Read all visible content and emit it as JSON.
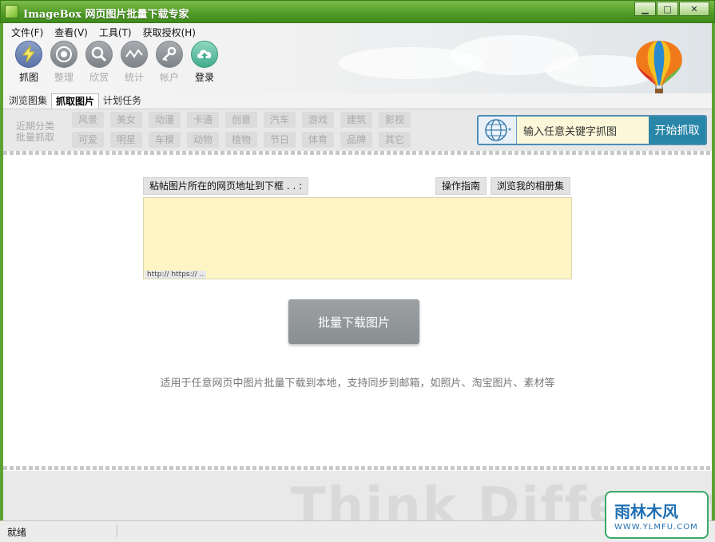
{
  "window": {
    "title": "ImageBox 网页图片批量下载专家",
    "minimize": "▁",
    "maximize": "□",
    "close": "✕"
  },
  "menu": [
    {
      "label": "文件(F)"
    },
    {
      "label": "查看(V)"
    },
    {
      "label": "工具(T)"
    },
    {
      "label": "获取授权(H)"
    }
  ],
  "toolbar": [
    {
      "label": "抓图",
      "icon": "lightning-icon",
      "active": true
    },
    {
      "label": "整理",
      "icon": "eye-icon",
      "active": false
    },
    {
      "label": "欣赏",
      "icon": "magnifier-icon",
      "active": false
    },
    {
      "label": "统计",
      "icon": "chart-icon",
      "active": false
    },
    {
      "label": "帐户",
      "icon": "key-icon",
      "active": false
    },
    {
      "label": "登录",
      "icon": "cloud-upload-icon",
      "active": true
    }
  ],
  "tabs": [
    {
      "label": "浏览图集",
      "active": false
    },
    {
      "label": "抓取图片",
      "active": true
    },
    {
      "label": "计划任务",
      "active": false
    }
  ],
  "categories": {
    "label_1": "近期分类",
    "label_2": "批量抓取",
    "row1": [
      "风景",
      "美女",
      "动漫",
      "卡通",
      "创意",
      "汽车",
      "游戏",
      "建筑",
      "影视"
    ],
    "row2": [
      "可爱",
      "明星",
      "车模",
      "动物",
      "植物",
      "节日",
      "体育",
      "品牌",
      "其它"
    ]
  },
  "search": {
    "value": "输入任意关键字抓图",
    "button": "开始抓取"
  },
  "main": {
    "paste_label": "粘帖图片所在的网页地址到下框 . . :",
    "guide_button": "操作指南",
    "album_button": "浏览我的相册集",
    "url_hint": "http:// https:// ..",
    "download_button": "批量下载图片",
    "description": "适用于任意网页中图片批量下载到本地，支持同步到邮箱，如照片、淘宝图片、素材等"
  },
  "footer": {
    "slogan": "Think Different"
  },
  "status": {
    "text": "就绪"
  },
  "watermark": {
    "line1": "雨林木风",
    "line2": "WWW.YLMFU.COM"
  },
  "colors": {
    "title_green": "#4f9a26",
    "search_blue": "#2a86a8",
    "url_area": "#fdf5c4"
  }
}
